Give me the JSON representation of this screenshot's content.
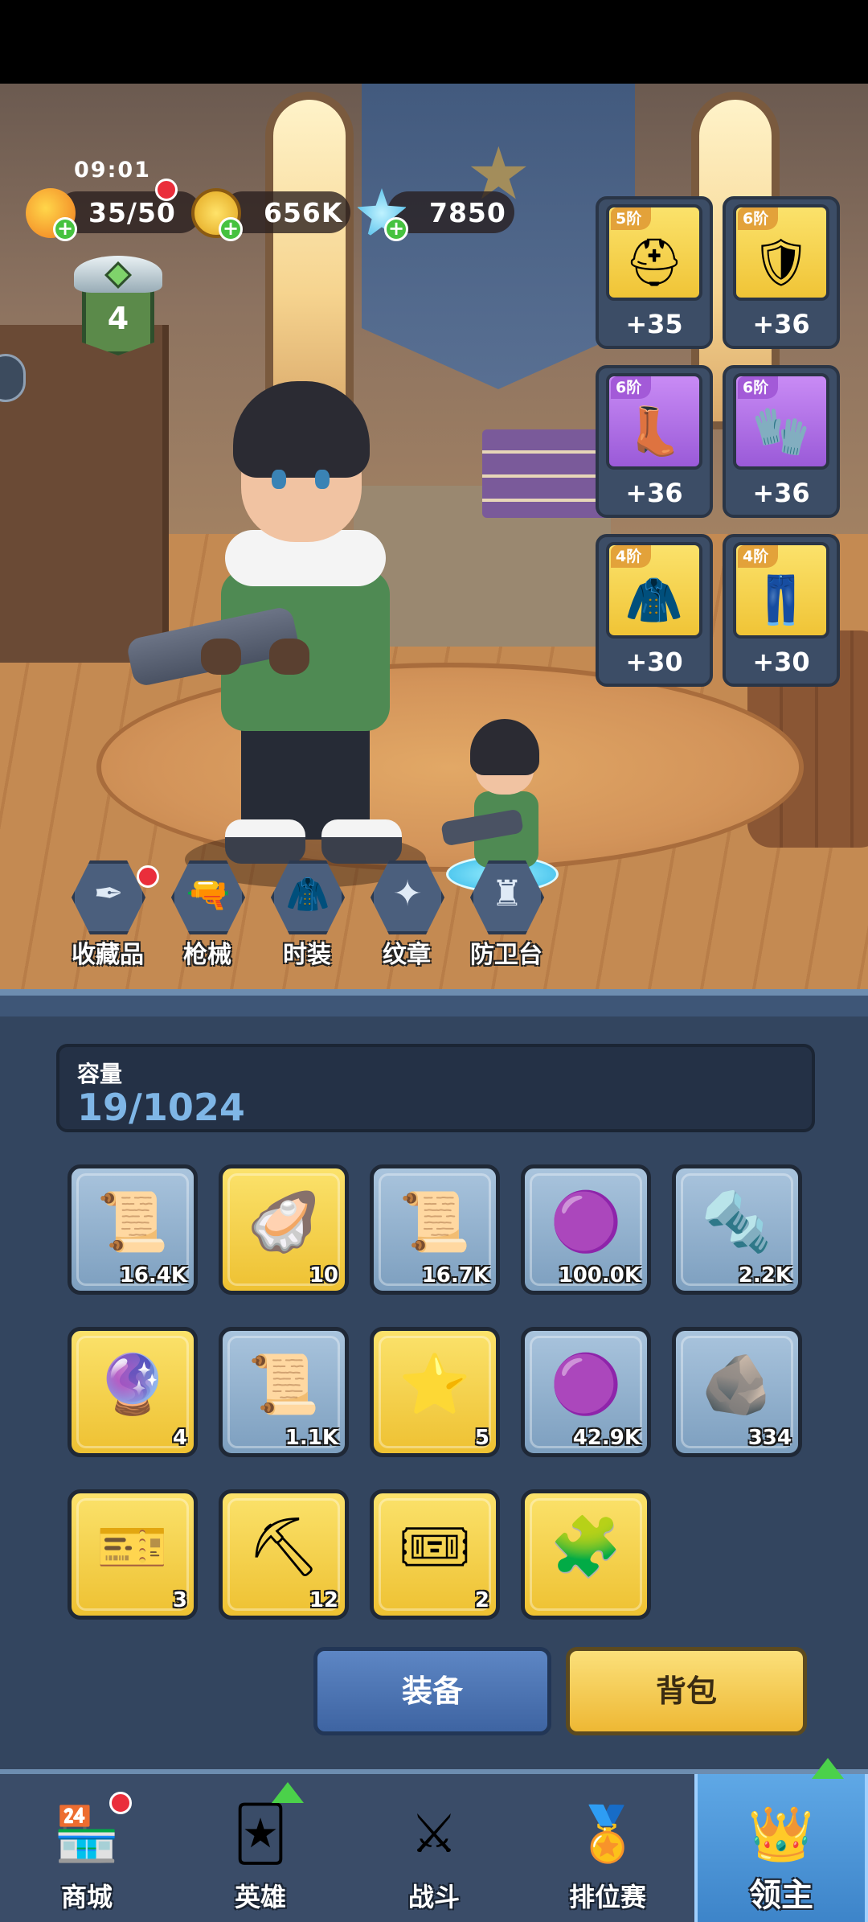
{
  "status_time": "09:01",
  "resources": {
    "energy": "35/50",
    "gold": "656K",
    "gems": "7850"
  },
  "player_level": "4",
  "equipment": [
    {
      "tier": "5阶",
      "bonus": "+35",
      "rarity": "gold",
      "icon": "helmet-icon"
    },
    {
      "tier": "6阶",
      "bonus": "+36",
      "rarity": "gold",
      "icon": "armor-icon"
    },
    {
      "tier": "6阶",
      "bonus": "+36",
      "rarity": "purple",
      "icon": "boots-icon"
    },
    {
      "tier": "6阶",
      "bonus": "+36",
      "rarity": "purple",
      "icon": "gloves-icon"
    },
    {
      "tier": "4阶",
      "bonus": "+30",
      "rarity": "gold",
      "icon": "cloak-icon"
    },
    {
      "tier": "4阶",
      "bonus": "+30",
      "rarity": "gold",
      "icon": "pants-icon"
    }
  ],
  "features": [
    "收藏品",
    "枪械",
    "时装",
    "纹章",
    "防卫台"
  ],
  "bag": {
    "capacity_label": "容量",
    "capacity_value": "19/1024",
    "items": [
      {
        "count": "16.4K",
        "rarity": "blue",
        "icon": "scroll-icon"
      },
      {
        "count": "10",
        "rarity": "gold",
        "icon": "pearl-shell-icon"
      },
      {
        "count": "16.7K",
        "rarity": "blue",
        "icon": "scroll-icon"
      },
      {
        "count": "100.0K",
        "rarity": "blue",
        "icon": "purple-goo-icon"
      },
      {
        "count": "2.2K",
        "rarity": "blue",
        "icon": "bolt-nut-icon"
      },
      {
        "count": "4",
        "rarity": "gold",
        "icon": "purple-orb-icon"
      },
      {
        "count": "1.1K",
        "rarity": "blue",
        "icon": "scroll-icon"
      },
      {
        "count": "5",
        "rarity": "gold",
        "icon": "star-scroll-icon"
      },
      {
        "count": "42.9K",
        "rarity": "blue",
        "icon": "purple-goo-icon"
      },
      {
        "count": "334",
        "rarity": "blue",
        "icon": "whetstone-icon"
      },
      {
        "count": "3",
        "rarity": "gold",
        "icon": "ticket-icon"
      },
      {
        "count": "12",
        "rarity": "gold",
        "icon": "pickaxe-icon"
      },
      {
        "count": "2",
        "rarity": "gold",
        "icon": "fashion-ticket-icon"
      },
      {
        "count": "",
        "rarity": "gold",
        "icon": "puzzle-piece-icon"
      }
    ]
  },
  "buttons": {
    "equip": "装备",
    "bag": "背包"
  },
  "nav": [
    "商城",
    "英雄",
    "战斗",
    "排位赛",
    "领主"
  ]
}
